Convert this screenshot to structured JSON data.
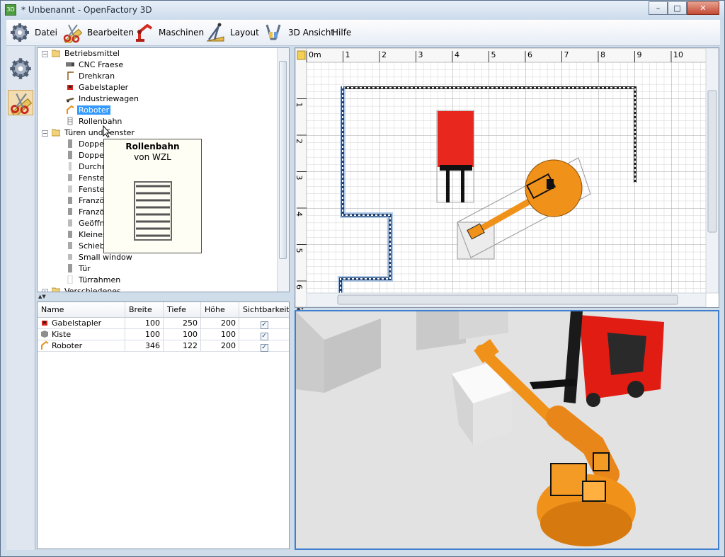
{
  "window": {
    "title": "* Unbenannt - OpenFactory 3D",
    "app_icon": "openfactory-app-icon",
    "buttons": {
      "minimize": "–",
      "maximize": "□",
      "close": "✕"
    }
  },
  "menu": [
    {
      "label": "Datei",
      "icon": "gear-icon"
    },
    {
      "label": "Bearbeiten",
      "icon": "scissors-ruler-icon"
    },
    {
      "label": "Maschinen",
      "icon": "robot-arm-icon"
    },
    {
      "label": "Layout",
      "icon": "drafting-icon"
    },
    {
      "label": "3D Ansicht",
      "icon": "glasses-icon"
    },
    {
      "label": "Hilfe",
      "icon": ""
    }
  ],
  "tree": {
    "groups": [
      {
        "label": "Betriebsmittel",
        "items": [
          "CNC Fraese",
          "Drehkran",
          "Gabelstapler",
          "Industriewagen",
          "Roboter",
          "Rollenbahn"
        ]
      },
      {
        "label": "Türen und Fenster",
        "items": [
          "Doppelt",
          "Doppelt",
          "Durchre",
          "Fenster",
          "Fenster",
          "Französ",
          "Französ",
          "Geöffne",
          "Kleines",
          "Schiebe",
          "Small window",
          "Tür",
          "Türrahmen"
        ]
      },
      {
        "label": "Verschiedenes",
        "items": []
      }
    ],
    "selected": "Roboter"
  },
  "tooltip": {
    "title": "Rollenbahn",
    "subtitle": "von WZL"
  },
  "table": {
    "columns": [
      "Name",
      "Breite",
      "Tiefe",
      "Höhe",
      "Sichtbarkeit"
    ],
    "rows": [
      {
        "name": "Gabelstapler",
        "breite": "100",
        "tiefe": "250",
        "hoehe": "200",
        "visible": true,
        "icon": "forklift-icon"
      },
      {
        "name": "Kiste",
        "breite": "100",
        "tiefe": "100",
        "hoehe": "100",
        "visible": true,
        "icon": "crate-icon"
      },
      {
        "name": "Roboter",
        "breite": "346",
        "tiefe": "122",
        "hoehe": "200",
        "visible": true,
        "icon": "robot-icon"
      }
    ]
  },
  "plan": {
    "ruler_x": [
      "0m",
      "1",
      "2",
      "3",
      "4",
      "5",
      "6",
      "7",
      "8",
      "9",
      "10"
    ],
    "ruler_y": [
      "1",
      "2",
      "3",
      "4",
      "5",
      "6"
    ]
  },
  "colors": {
    "selection": "#3399ff",
    "robot": "#f0911a",
    "forklift": "#e8281e",
    "wall_selected": "#3a6fb0"
  }
}
